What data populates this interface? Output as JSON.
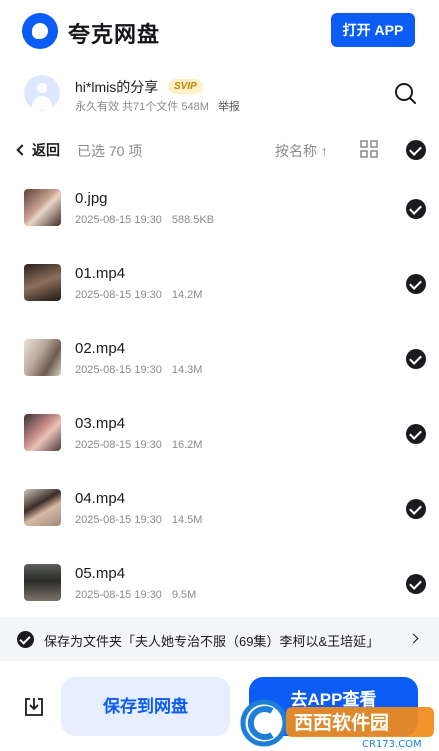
{
  "header": {
    "brand": "夸克网盘",
    "open_app_label": "打开 APP"
  },
  "share": {
    "title": "hi*lmis的分享",
    "badge": "SVIP",
    "validity": "永久有效",
    "summary": "共71个文件 548M",
    "report_label": "举报"
  },
  "toolbar": {
    "back_label": "返回",
    "selected_text": "已选 70 项",
    "sort_label": "按名称 ↑"
  },
  "files": [
    {
      "name": "0.jpg",
      "date": "2025-08-15 19:30",
      "size": "588.5KB",
      "selected": true
    },
    {
      "name": "01.mp4",
      "date": "2025-08-15 19:30",
      "size": "14.2M",
      "selected": true
    },
    {
      "name": "02.mp4",
      "date": "2025-08-15 19:30",
      "size": "14.3M",
      "selected": true
    },
    {
      "name": "03.mp4",
      "date": "2025-08-15 19:30",
      "size": "16.2M",
      "selected": true
    },
    {
      "name": "04.mp4",
      "date": "2025-08-15 19:30",
      "size": "14.5M",
      "selected": true
    },
    {
      "name": "05.mp4",
      "date": "2025-08-15 19:30",
      "size": "9.5M",
      "selected": true
    }
  ],
  "folder_bar": {
    "text": "保存为文件夹「夫人她专治不服（69集）李柯以&王培延」"
  },
  "bottom": {
    "save_label": "保存到网盘",
    "app_label": "去APP查看"
  },
  "watermark": {
    "text_main": "西西软件园",
    "text_sub": "CR173.COM"
  },
  "colors": {
    "accent": "#0a5cf5",
    "text": "#1b1b1f",
    "muted": "#8a8a8f"
  }
}
